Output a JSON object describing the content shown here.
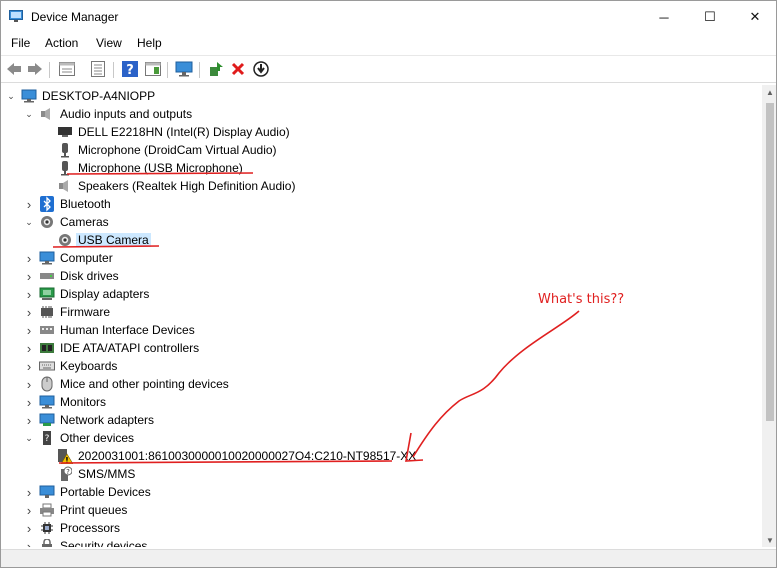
{
  "window": {
    "title": "Device Manager",
    "minimize_glyph": "─",
    "maximize_glyph": "☐",
    "close_glyph": "✕"
  },
  "menu": [
    "File",
    "Action",
    "View",
    "Help"
  ],
  "toolbar": [
    {
      "icon": "back-arrow-icon"
    },
    {
      "icon": "forward-arrow-icon"
    },
    {
      "icon": "properties-icon"
    },
    {
      "icon": "list-view-icon"
    },
    {
      "icon": "help-icon"
    },
    {
      "icon": "action-pane-icon"
    },
    {
      "icon": "monitor-icon"
    },
    {
      "icon": "update-driver-icon"
    },
    {
      "icon": "uninstall-icon"
    },
    {
      "icon": "download-icon"
    }
  ],
  "tree": {
    "root": "DESKTOP-A4NIOPP",
    "items": [
      {
        "label": "Audio inputs and outputs",
        "level": 1,
        "expander": "expanded",
        "icon": "speaker-icon"
      },
      {
        "label": "DELL E2218HN (Intel(R) Display Audio)",
        "level": 2,
        "icon": "display-audio-icon"
      },
      {
        "label": "Microphone (DroidCam Virtual Audio)",
        "level": 2,
        "icon": "microphone-icon"
      },
      {
        "label": "Microphone (USB Microphone)",
        "level": 2,
        "icon": "microphone-icon"
      },
      {
        "label": "Speakers (Realtek High Definition Audio)",
        "level": 2,
        "icon": "speaker-icon"
      },
      {
        "label": "Bluetooth",
        "level": 1,
        "expander": "collapsed",
        "icon": "bluetooth-icon"
      },
      {
        "label": "Cameras",
        "level": 1,
        "expander": "expanded",
        "icon": "camera-icon"
      },
      {
        "label": "USB Camera",
        "level": 2,
        "icon": "camera-icon",
        "selected": true
      },
      {
        "label": "Computer",
        "level": 1,
        "expander": "collapsed",
        "icon": "computer-icon"
      },
      {
        "label": "Disk drives",
        "level": 1,
        "expander": "collapsed",
        "icon": "disk-icon"
      },
      {
        "label": "Display adapters",
        "level": 1,
        "expander": "collapsed",
        "icon": "display-adapter-icon"
      },
      {
        "label": "Firmware",
        "level": 1,
        "expander": "collapsed",
        "icon": "firmware-icon"
      },
      {
        "label": "Human Interface Devices",
        "level": 1,
        "expander": "collapsed",
        "icon": "hid-icon"
      },
      {
        "label": "IDE ATA/ATAPI controllers",
        "level": 1,
        "expander": "collapsed",
        "icon": "ide-icon"
      },
      {
        "label": "Keyboards",
        "level": 1,
        "expander": "collapsed",
        "icon": "keyboard-icon"
      },
      {
        "label": "Mice and other pointing devices",
        "level": 1,
        "expander": "collapsed",
        "icon": "mouse-icon"
      },
      {
        "label": "Monitors",
        "level": 1,
        "expander": "collapsed",
        "icon": "monitor-icon"
      },
      {
        "label": "Network adapters",
        "level": 1,
        "expander": "collapsed",
        "icon": "network-icon"
      },
      {
        "label": "Other devices",
        "level": 1,
        "expander": "expanded",
        "icon": "other-devices-icon"
      },
      {
        "label": "2020031001:8610030000010020000027O4:C210-NT98517-XX",
        "level": 2,
        "icon": "warning-device-icon"
      },
      {
        "label": "SMS/MMS",
        "level": 2,
        "icon": "unknown-device-icon"
      },
      {
        "label": "Portable Devices",
        "level": 1,
        "expander": "collapsed",
        "icon": "portable-device-icon"
      },
      {
        "label": "Print queues",
        "level": 1,
        "expander": "collapsed",
        "icon": "printer-icon"
      },
      {
        "label": "Processors",
        "level": 1,
        "expander": "collapsed",
        "icon": "processor-icon"
      },
      {
        "label": "Security devices",
        "level": 1,
        "expander": "collapsed",
        "icon": "security-icon"
      }
    ]
  },
  "annotation": {
    "text": "What's this??",
    "color": "#e02020"
  },
  "colors": {
    "selection": "#cce8ff",
    "accent": "#0078d7",
    "annotation": "#e02020"
  }
}
